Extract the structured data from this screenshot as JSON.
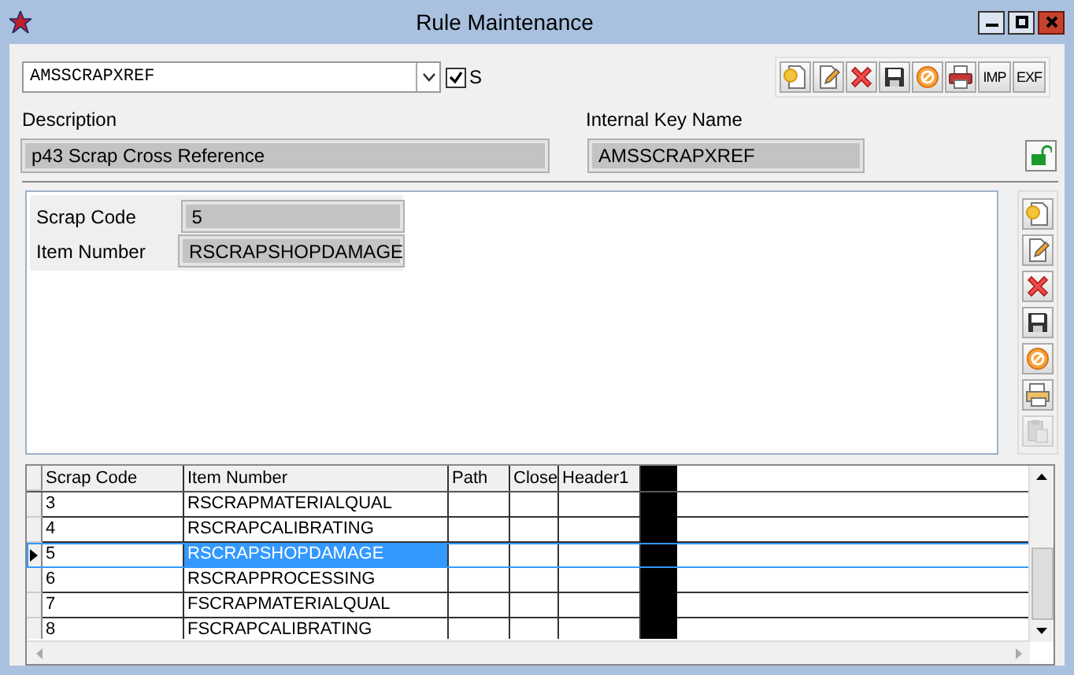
{
  "window": {
    "title": "Rule Maintenance"
  },
  "rule_select": {
    "value": "AMSSCRAPXREF",
    "checkbox": {
      "label": "S",
      "checked": true
    }
  },
  "toolbar": {
    "text_buttons": [
      "IMP",
      "EXF"
    ]
  },
  "description": {
    "label": "Description",
    "value": "p43 Scrap Cross Reference"
  },
  "internal_key": {
    "label": "Internal Key Name",
    "value": "AMSSCRAPXREF"
  },
  "lock": {
    "locked": false
  },
  "detail_fields": [
    {
      "label": "Scrap Code",
      "value": "5"
    },
    {
      "label": "Item Number",
      "value": "RSCRAPSHOPDAMAGE"
    }
  ],
  "side_toolbar": [
    {
      "disabled": false
    },
    {
      "disabled": false
    },
    {
      "disabled": false
    },
    {
      "disabled": false
    },
    {
      "disabled": false
    },
    {
      "disabled": false
    },
    {
      "disabled": true
    }
  ],
  "table": {
    "columns": [
      "Scrap Code",
      "Item Number",
      "Path",
      "Close",
      "Header1"
    ],
    "rows": [
      {
        "cells": [
          "3",
          "RSCRAPMATERIALQUAL"
        ],
        "selected": false
      },
      {
        "cells": [
          "4",
          "RSCRAPCALIBRATING"
        ],
        "selected": false
      },
      {
        "cells": [
          "5",
          "RSCRAPSHOPDAMAGE"
        ],
        "selected": true
      },
      {
        "cells": [
          "6",
          "RSCRAPPROCESSING"
        ],
        "selected": false
      },
      {
        "cells": [
          "7",
          "FSCRAPMATERIALQUAL"
        ],
        "selected": false
      },
      {
        "cells": [
          "8",
          "FSCRAPCALIBRATING"
        ],
        "selected": false
      }
    ]
  }
}
